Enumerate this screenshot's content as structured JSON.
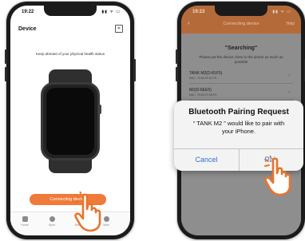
{
  "left_phone": {
    "status_time": "19:22",
    "status_icons": "▮▮ ᯤ ▭",
    "title": "Device",
    "scan_icon": "scan-icon",
    "subtitle": "Keep abreast of your physical health status",
    "connect_button": "Connecting device",
    "tabs": [
      {
        "label": "Home",
        "icon": "home-icon"
      },
      {
        "label": "Sport",
        "icon": "sport-icon"
      },
      {
        "label": "Device",
        "icon": "device-icon"
      },
      {
        "label": "Mine",
        "icon": "user-icon"
      }
    ]
  },
  "right_phone": {
    "status_time": "19:23",
    "status_icons": "▮▮ ᯤ ▭",
    "nav_title": "Connecting device",
    "nav_help": "Help",
    "back_icon": "back-icon",
    "searching": "\"Searching\"",
    "hint": "Please put the device close to the phone as much as possible",
    "devices": [
      {
        "name": "TANK M2(D-81F5)",
        "mac": "MAC: 76:63:EF:81:F5"
      },
      {
        "name": "M2(D-6EE5)",
        "mac": "MAC: 76:63:EF:6E:E5"
      }
    ]
  },
  "alert": {
    "title": "Bluetooth Pairing Request",
    "message_line1": "“ TANK M2   ” would like to pair with",
    "message_line2": "your iPhone.",
    "cancel": "Cancel",
    "pair": "Pair"
  },
  "colors": {
    "accent": "#f07a3a",
    "ios_blue": "#2f6fd8"
  }
}
